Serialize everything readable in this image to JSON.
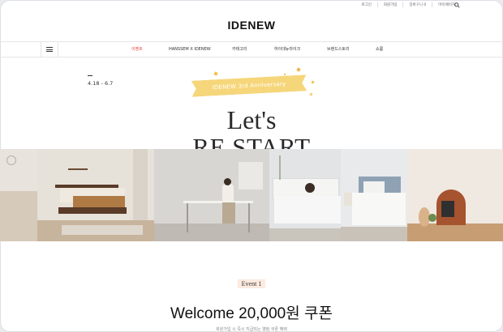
{
  "utility": {
    "login": "로그인",
    "join": "회원가입",
    "cart": "장바구니 0",
    "mypage": "마이페이지"
  },
  "logo": "IDENEW",
  "nav": {
    "items": [
      "이벤트",
      "HANSSEM X IDENEW",
      "카테고리",
      "하이데뉴라이크",
      "브랜드스토리",
      "쇼룸"
    ],
    "active_index": 0
  },
  "hero": {
    "date_range": "4.18 - 6.7",
    "ribbon": "IDENEW 3rd Anniversary",
    "title_line1": "Let's",
    "title_line2": "RE START"
  },
  "event": {
    "badge": "Event 1",
    "headline": "Welcome 20,000원 쿠폰",
    "subtext": "회원가입 시 즉시 지급되는 웰컴 쿠폰 혜택"
  },
  "colors": {
    "accent": "#e0403a",
    "ribbon": "#f6d67a",
    "event_badge_bg": "#fbeadf"
  },
  "icons": {
    "search": "search-icon",
    "menu": "hamburger-menu-icon"
  }
}
